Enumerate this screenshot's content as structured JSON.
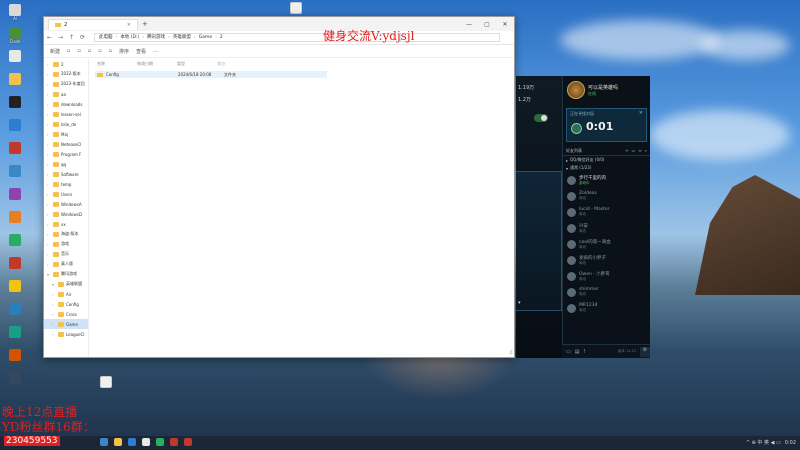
{
  "desktop": {
    "icons": [
      {
        "label": "Ai",
        "color": "#d9d9d9"
      },
      {
        "label": "Clash",
        "color": "#4a8f3c"
      },
      {
        "label": "",
        "color": "#e8e8e8"
      },
      {
        "label": "",
        "color": "#f2c14e"
      },
      {
        "label": "",
        "color": "#222"
      },
      {
        "label": "",
        "color": "#2d7dd2"
      },
      {
        "label": "",
        "color": "#c0392b"
      },
      {
        "label": "",
        "color": "#3a86c8"
      },
      {
        "label": "",
        "color": "#8e44ad"
      },
      {
        "label": "",
        "color": "#e67e22"
      },
      {
        "label": "",
        "color": "#27ae60"
      },
      {
        "label": "",
        "color": "#c0392b"
      },
      {
        "label": "",
        "color": "#f1c40f"
      },
      {
        "label": "",
        "color": "#2980b9"
      },
      {
        "label": "",
        "color": "#16a085"
      },
      {
        "label": "",
        "color": "#d35400"
      },
      {
        "label": "",
        "color": "#34495e"
      }
    ],
    "file_icon_label": ""
  },
  "explorer": {
    "tab_title": "2",
    "address_parts": [
      "此电脑",
      "本地 (D:)",
      "腾讯游戏",
      "英雄联盟",
      "Game",
      "2"
    ],
    "search_placeholder": "",
    "toolbar": [
      "新建",
      "",
      "",
      "",
      "",
      "",
      "排序",
      "查看",
      "..."
    ],
    "columns": [
      "名称",
      "修改日期",
      "类型",
      "大小"
    ],
    "file": {
      "name": "Config",
      "date": "2024/6/18 20:08",
      "type": "文件夹",
      "size": ""
    },
    "sidebar": [
      {
        "label": "2",
        "open": false,
        "sel": false
      },
      {
        "label": "2022-版本",
        "open": false,
        "sel": false
      },
      {
        "label": "2023-年度回",
        "open": false,
        "sel": false
      },
      {
        "label": "aa",
        "open": false,
        "sel": false
      },
      {
        "label": "downloads",
        "open": false,
        "sel": false
      },
      {
        "label": "lesson-sel",
        "open": false,
        "sel": false
      },
      {
        "label": "lolio_de",
        "open": false,
        "sel": false
      },
      {
        "label": "Maj",
        "open": false,
        "sel": false
      },
      {
        "label": "NeteaseCl",
        "open": false,
        "sel": false
      },
      {
        "label": "Program F",
        "open": false,
        "sel": false
      },
      {
        "label": "qq",
        "open": false,
        "sel": false
      },
      {
        "label": "Software",
        "open": false,
        "sel": false
      },
      {
        "label": "temp",
        "open": false,
        "sel": false
      },
      {
        "label": "Users",
        "open": false,
        "sel": false
      },
      {
        "label": "WindowsA",
        "open": false,
        "sel": false
      },
      {
        "label": "WindowsD",
        "open": false,
        "sel": false
      },
      {
        "label": "xx",
        "open": false,
        "sel": false
      },
      {
        "label": "海盗-版本",
        "open": false,
        "sel": false
      },
      {
        "label": "游戏",
        "open": false,
        "sel": false
      },
      {
        "label": "音乐",
        "open": false,
        "sel": false
      },
      {
        "label": "真人版",
        "open": false,
        "sel": false
      },
      {
        "label": "腾讯游戏",
        "open": true,
        "sel": false
      },
      {
        "label": "英雄联盟",
        "open": true,
        "sel": false
      },
      {
        "label": "Air",
        "open": false,
        "sel": false
      },
      {
        "label": "Config",
        "open": false,
        "sel": false
      },
      {
        "label": "Cross",
        "open": false,
        "sel": false
      },
      {
        "label": "Game",
        "open": false,
        "sel": true
      },
      {
        "label": "LeagueCl",
        "open": false,
        "sel": false
      }
    ]
  },
  "game": {
    "left": {
      "stat1": "1.19万",
      "stat2": "1.2万"
    },
    "profile": {
      "name": "可以是英雄吗",
      "status": "在线"
    },
    "timer": {
      "label": "正在寻找对局",
      "close": "×",
      "time": "0:01"
    },
    "social": {
      "title": "好友列表",
      "group1": "QQ/微信好友 (0/0)",
      "group2": "通常 (1/23)"
    },
    "friends": [
      {
        "name": "步行千里的肉",
        "status": "游戏中",
        "online": true
      },
      {
        "name": "Zoldeas",
        "status": "离线",
        "online": false
      },
      {
        "name": "lucid - Master",
        "status": "离线",
        "online": false
      },
      {
        "name": "兴安",
        "status": "离线",
        "online": false
      },
      {
        "name": "cool的第一滴血",
        "status": "离线",
        "online": false
      },
      {
        "name": "发疯的小胖子",
        "status": "离线",
        "online": false
      },
      {
        "name": "Owen · 小胖哥",
        "status": "离线",
        "online": false
      },
      {
        "name": "shimmer",
        "status": "离线",
        "online": false
      },
      {
        "name": "MR1234",
        "status": "离线",
        "online": false
      }
    ],
    "bottom": {
      "version": "版本 14.12"
    }
  },
  "overlays": {
    "top_text": "健身交流V:ydjsjl",
    "bottom_line1": "晚上12点直播",
    "bottom_line2": "YD粉丝群16群：",
    "qq_group": "230459553"
  },
  "taskbar": {
    "icon_colors": [
      "#3a86c8",
      "#f2c14e",
      "#2d7dd2",
      "#e8e8e8",
      "#27ae60",
      "#c0392b",
      "#c0392b"
    ],
    "tray": "^ ⊕ 中 英 ◀ ▭",
    "time": "0:02",
    "date": "2024/6/18"
  }
}
